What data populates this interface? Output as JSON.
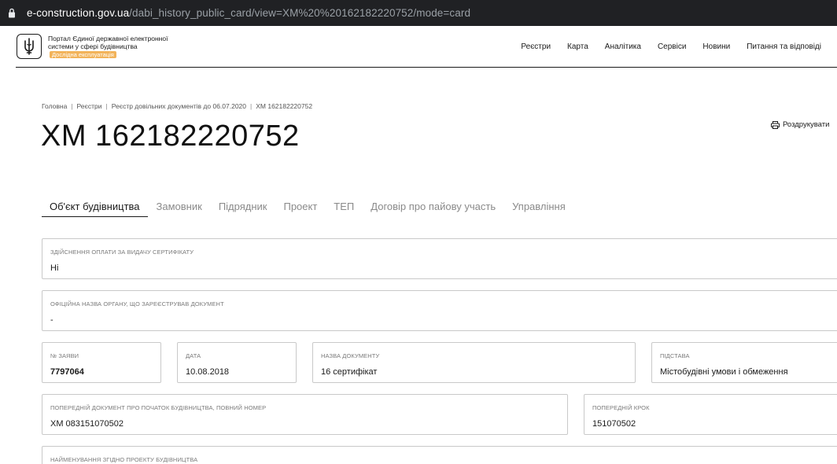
{
  "browser": {
    "url_host": "e-construction.gov.ua",
    "url_path": "/dabi_history_public_card/view=XM%20%20162182220752/mode=card"
  },
  "header": {
    "portal_title": "Портал Єдиної державної електронної системи у сфері будівництва",
    "badge": "Дослідна експлуатація",
    "nav": [
      "Реєстри",
      "Карта",
      "Аналітика",
      "Сервіси",
      "Новини",
      "Питання та відповіді"
    ]
  },
  "breadcrumb": [
    "Головна",
    "Реєстри",
    "Реєстр довільних документів до 06.07.2020",
    "ХМ 162182220752"
  ],
  "page": {
    "title": "ХМ 162182220752",
    "print_label": "Роздрукувати"
  },
  "tabs": [
    "Об'єкт будівництва",
    "Замовник",
    "Підрядник",
    "Проект",
    "ТЕП",
    "Договір про пайову участь",
    "Управління"
  ],
  "fields": {
    "payment": {
      "label": "Здійснення оплати за видачу сертифікату",
      "value": "Ні"
    },
    "authority": {
      "label": "Офіційна назва органу, що зареєстрував документ",
      "value": "-"
    },
    "application_no": {
      "label": "№ заяви",
      "value": "7797064"
    },
    "date": {
      "label": "Дата",
      "value": "10.08.2018"
    },
    "doc_name": {
      "label": "Назва документу",
      "value": "16 сертифікат"
    },
    "basis": {
      "label": "Підстава",
      "value": "Містобудівні умови і обмеження"
    },
    "prev_doc": {
      "label": "Попередній документ про початок будівництва, повний номер",
      "value": "ХМ 083151070502"
    },
    "prev_step": {
      "label": "Попередній крок",
      "value": "151070502"
    },
    "project_name": {
      "label": "Найменування згідно проекту будівництва",
      "value": ""
    }
  }
}
